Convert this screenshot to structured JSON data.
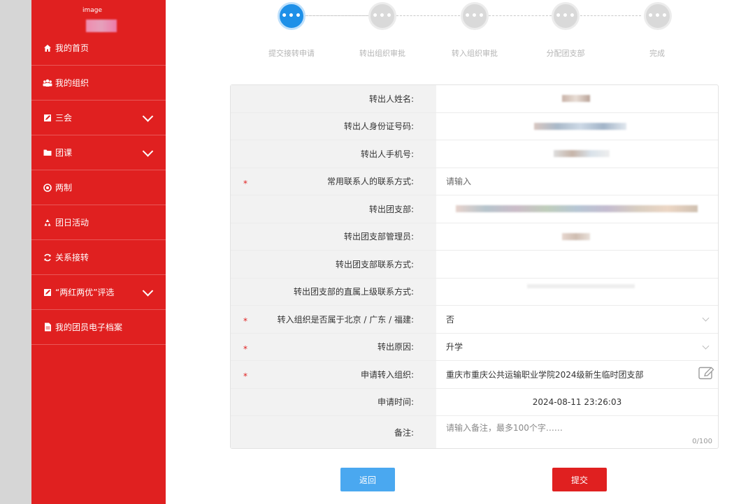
{
  "sidebar": {
    "logo_alt": "image",
    "items": [
      {
        "label": "我的首页",
        "icon": "home-icon",
        "expandable": false
      },
      {
        "label": "我的组织",
        "icon": "users-icon",
        "expandable": false
      },
      {
        "label": "三会",
        "icon": "edit-icon",
        "expandable": true
      },
      {
        "label": "团课",
        "icon": "folder-icon",
        "expandable": true
      },
      {
        "label": "两制",
        "icon": "target-icon",
        "expandable": false
      },
      {
        "label": "团日活动",
        "icon": "recycle-icon",
        "expandable": false
      },
      {
        "label": "关系接转",
        "icon": "refresh-icon",
        "expandable": false
      },
      {
        "label": "“两红两优”评选",
        "icon": "edit-icon",
        "expandable": true
      },
      {
        "label": "我的团员电子档案",
        "icon": "file-icon",
        "expandable": false
      }
    ]
  },
  "steps": [
    {
      "label": "提交接转申请",
      "active": true
    },
    {
      "label": "转出组织审批",
      "active": false
    },
    {
      "label": "转入组织审批",
      "active": false
    },
    {
      "label": "分配团支部",
      "active": false
    },
    {
      "label": "完成",
      "active": false
    }
  ],
  "form": {
    "rows": [
      {
        "label": "转出人姓名:",
        "required": false,
        "value": ""
      },
      {
        "label": "转出人身份证号码:",
        "required": false,
        "value": ""
      },
      {
        "label": "转出人手机号:",
        "required": false,
        "value": ""
      },
      {
        "label": "常用联系人的联系方式:",
        "required": true,
        "value": "",
        "placeholder": "请输入"
      },
      {
        "label": "转出团支部:",
        "required": false,
        "value": ""
      },
      {
        "label": "转出团支部管理员:",
        "required": false,
        "value": ""
      },
      {
        "label": "转出团支部联系方式:",
        "required": false,
        "value": ""
      },
      {
        "label": "转出团支部的直属上级联系方式:",
        "required": false,
        "value": ""
      },
      {
        "label": "转入组织是否属于北京 / 广东 / 福建:",
        "required": true,
        "value": "否",
        "dropdown": true
      },
      {
        "label": "转出原因:",
        "required": true,
        "value": "升学",
        "dropdown": true
      },
      {
        "label": "申请转入组织:",
        "required": true,
        "value": "重庆市重庆公共运输职业学院2024级新生临时团支部"
      },
      {
        "label": "申请时间:",
        "required": false,
        "value": "2024-08-11 23:26:03"
      },
      {
        "label": "备注:",
        "required": false,
        "placeholder": "请输入备注，最多100个字……",
        "counter": "0/100"
      }
    ]
  },
  "buttons": {
    "back": "返回",
    "submit": "提交"
  },
  "colors": {
    "sidebar": "#e02020",
    "active_step": "#1e90e8",
    "back_button": "#4aa8f0",
    "submit_button": "#e02020"
  }
}
